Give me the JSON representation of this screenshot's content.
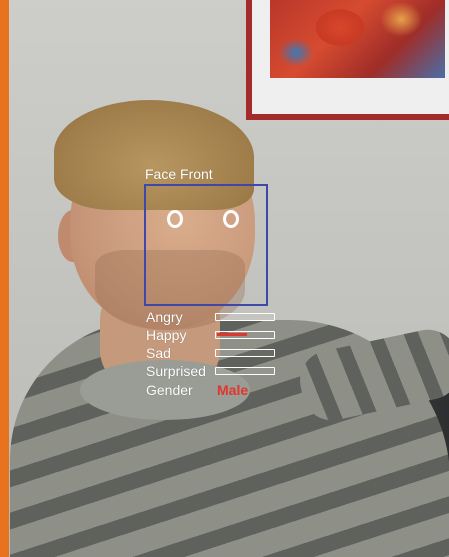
{
  "face_tracker": {
    "label": "Face Front",
    "box_color": "#3f47a8"
  },
  "emotions": [
    {
      "label": "Angry",
      "level": 0.0
    },
    {
      "label": "Happy",
      "level": 0.55
    },
    {
      "label": "Sad",
      "level": 0.0
    },
    {
      "label": "Surprised",
      "level": 0.0
    }
  ],
  "gender": {
    "label": "Gender",
    "value": "Male"
  },
  "colors": {
    "accent_red": "#e2362a",
    "side_bar_orange": "#e8731f",
    "text_white": "#ffffff"
  }
}
